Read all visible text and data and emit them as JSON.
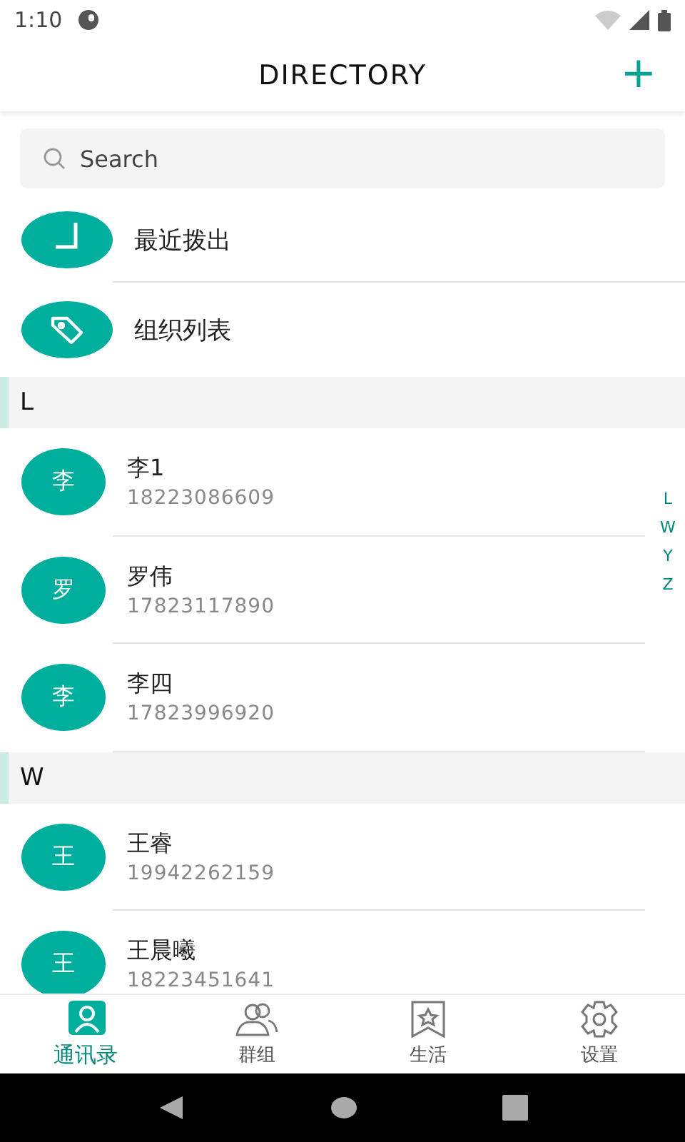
{
  "status_bar": {
    "time": "1:10"
  },
  "header": {
    "title": "DIRECTORY",
    "add_button": "+"
  },
  "search": {
    "placeholder": "Search"
  },
  "shortcuts": [
    {
      "kind": "clock",
      "label": "最近拨出"
    },
    {
      "kind": "tag",
      "label": "组织列表"
    }
  ],
  "sections": [
    {
      "letter": "L",
      "contacts": [
        {
          "avatar": "李",
          "name": "李1",
          "phone": "18223086609"
        },
        {
          "avatar": "罗",
          "name": "罗伟",
          "phone": "17823117890"
        },
        {
          "avatar": "李",
          "name": "李四",
          "phone": "17823996920"
        }
      ]
    },
    {
      "letter": "W",
      "contacts": [
        {
          "avatar": "王",
          "name": "王睿",
          "phone": "19942262159"
        },
        {
          "avatar": "王",
          "name": "王晨曦",
          "phone": "18223451641"
        }
      ]
    }
  ],
  "index_bar": [
    "L",
    "W",
    "Y",
    "Z"
  ],
  "tab_bar": [
    {
      "kind": "contacts",
      "label": "通讯录",
      "selected": true
    },
    {
      "kind": "group",
      "label": "群组",
      "selected": false
    },
    {
      "kind": "life",
      "label": "生活",
      "selected": false
    },
    {
      "kind": "settings",
      "label": "设置",
      "selected": false
    }
  ]
}
